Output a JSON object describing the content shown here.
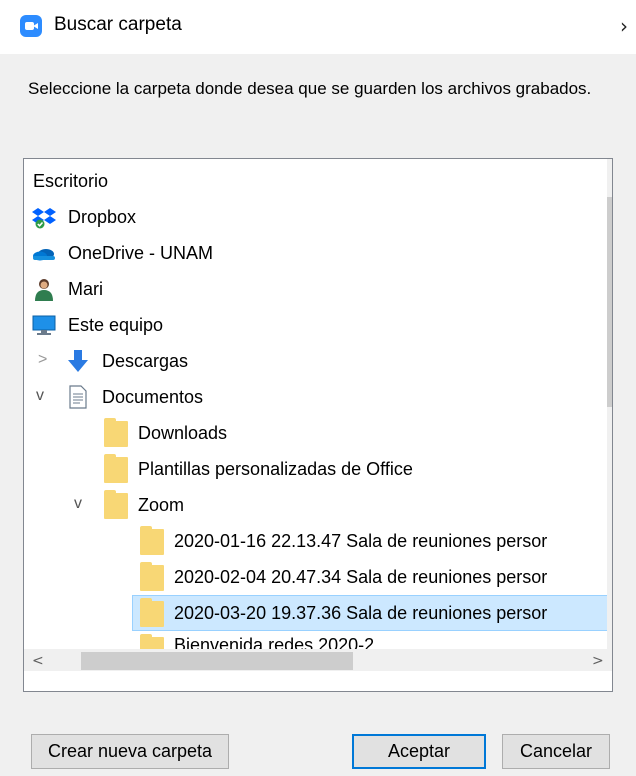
{
  "window": {
    "title": "Buscar carpeta",
    "close_label": "›"
  },
  "instruction": "Seleccione la carpeta donde desea que se guarden los archivos grabados.",
  "tree": {
    "items": [
      {
        "label": "Escritorio",
        "icon": "none"
      },
      {
        "label": "Dropbox",
        "icon": "dropbox-icon"
      },
      {
        "label": "OneDrive - UNAM",
        "icon": "onedrive-cloud-icon"
      },
      {
        "label": "Mari",
        "icon": "user-icon"
      },
      {
        "label": "Este equipo",
        "icon": "computer-icon"
      },
      {
        "label": "Descargas",
        "icon": "download-arrow-icon",
        "expander": ">"
      },
      {
        "label": "Documentos",
        "icon": "document-icon",
        "expander": "v"
      },
      {
        "label": "Downloads",
        "icon": "folder-icon"
      },
      {
        "label": "Plantillas personalizadas de Office",
        "icon": "folder-icon"
      },
      {
        "label": "Zoom",
        "icon": "folder-icon",
        "expander": "v"
      },
      {
        "label": "2020-01-16 22.13.47 Sala de reuniones persor",
        "icon": "folder-icon"
      },
      {
        "label": "2020-02-04 20.47.34 Sala de reuniones persor",
        "icon": "folder-icon"
      },
      {
        "label": "2020-03-20 19.37.36 Sala de reuniones persor",
        "icon": "folder-icon",
        "selected": true
      },
      {
        "label": "Bienvenida redes 2020-2",
        "icon": "folder-icon"
      }
    ]
  },
  "scroll": {
    "up": "^",
    "down": "v",
    "left": "<",
    "right": ">"
  },
  "buttons": {
    "new_folder": "Crear nueva carpeta",
    "accept": "Aceptar",
    "cancel": "Cancelar"
  },
  "colors": {
    "accent": "#0078d7",
    "selection": "#cce8ff",
    "folder": "#f8d775",
    "zoom_blue": "#2d8cff"
  }
}
